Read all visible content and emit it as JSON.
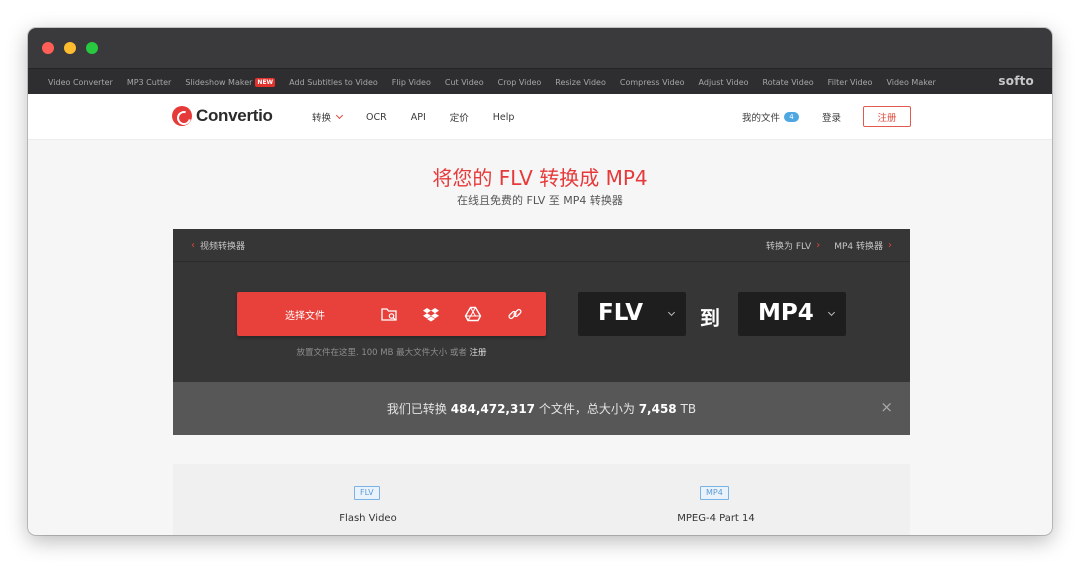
{
  "toolbar": {
    "links": [
      "Video Converter",
      "MP3 Cutter",
      "Slideshow Maker",
      "Add Subtitles to Video",
      "Flip Video",
      "Cut Video",
      "Crop Video",
      "Resize Video",
      "Compress Video",
      "Adjust Video",
      "Rotate Video",
      "Filter Video",
      "Video Maker"
    ],
    "new_badge": "NEW",
    "brand": "softo"
  },
  "navbar": {
    "logo_text": "Convertio",
    "convert_label": "转换",
    "ocr_label": "OCR",
    "api_label": "API",
    "pricing_label": "定价",
    "help_label": "Help",
    "my_files_label": "我的文件",
    "files_count": "4",
    "login_label": "登录",
    "signup_label": "注册"
  },
  "hero": {
    "title": "将您的 FLV 转换成 MP4",
    "subtitle": "在线且免费的 FLV 至 MP4 转换器"
  },
  "converter": {
    "back_crumb": "视频转换器",
    "crumb_convert_to": "转换为 FLV",
    "crumb_mp4": "MP4 转换器",
    "choose_file_label": "选择文件",
    "drop_hint_prefix": "放置文件在这里. 100 MB 最大文件大小 或者",
    "drop_hint_link": "注册",
    "from_format": "FLV",
    "to_word": "到",
    "to_format": "MP4"
  },
  "stats": {
    "prefix": "我们已转换",
    "file_count": "484,472,317",
    "middle": "个文件，总大小为",
    "total_size": "7,458",
    "unit": "TB",
    "close": "×"
  },
  "formats": {
    "from_tag": "FLV",
    "from_name": "Flash Video",
    "to_tag": "MP4",
    "to_name": "MPEG-4 Part 14"
  },
  "colors": {
    "accent": "#e8403b",
    "panel_dark": "#363636",
    "stats_bar": "#575757",
    "badge_blue": "#4ea7e3"
  }
}
